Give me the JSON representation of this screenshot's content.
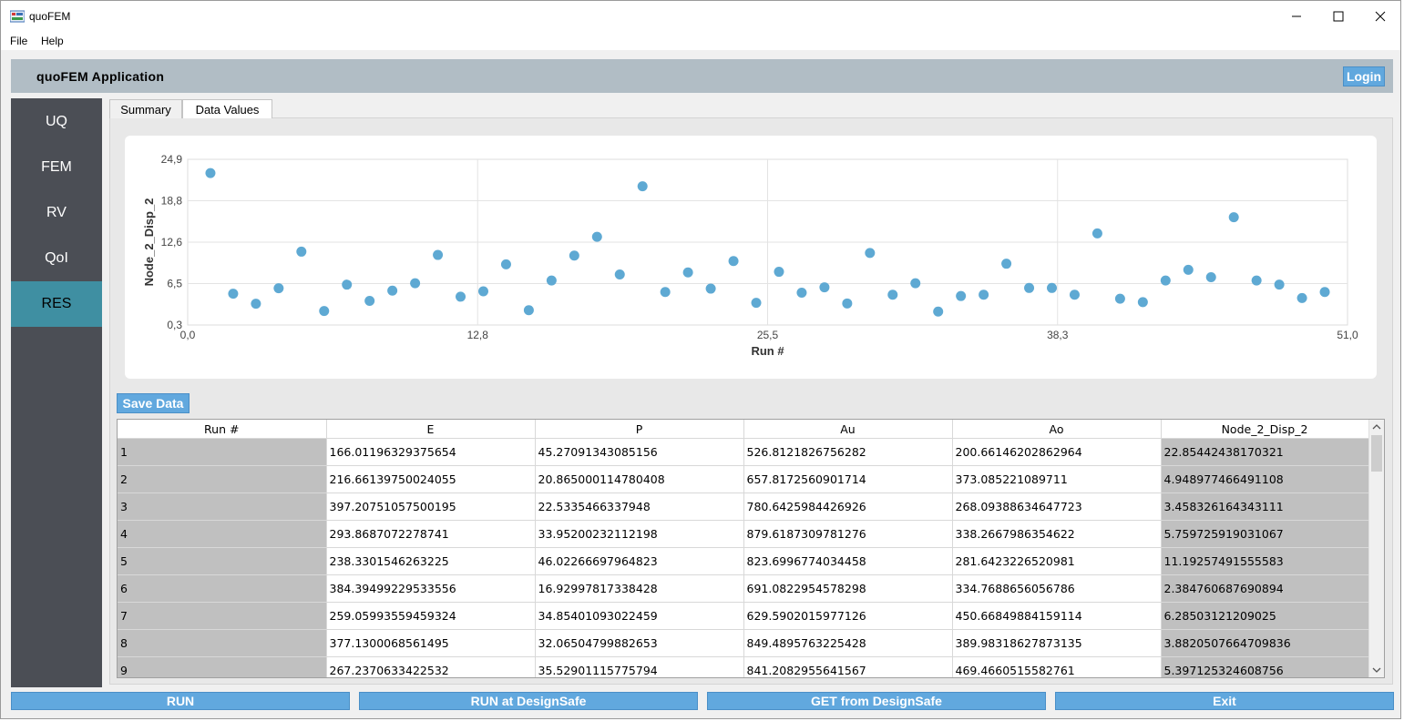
{
  "window": {
    "title": "quoFEM"
  },
  "menu": {
    "items": [
      "File",
      "Help"
    ]
  },
  "header": {
    "title": "quoFEM Application",
    "login_label": "Login"
  },
  "sidebar": {
    "items": [
      "UQ",
      "FEM",
      "RV",
      "QoI",
      "RES"
    ],
    "active": "RES"
  },
  "tabs": {
    "items": [
      "Summary",
      "Data Values"
    ],
    "active": "Data Values"
  },
  "buttons": {
    "save_data": "Save Data",
    "run": "RUN",
    "run_designsafe": "RUN at DesignSafe",
    "get_designsafe": "GET from DesignSafe",
    "exit": "Exit"
  },
  "table": {
    "columns": [
      "Run #",
      "E",
      "P",
      "Au",
      "Ao",
      "Node_2_Disp_2"
    ],
    "rows": [
      [
        "1",
        "166.01196329375654",
        "45.27091343085156",
        "526.8121826756282",
        "200.66146202862964",
        "22.85442438170321"
      ],
      [
        "2",
        "216.66139750024055",
        "20.865000114780408",
        "657.8172560901714",
        "373.085221089711",
        "4.948977466491108"
      ],
      [
        "3",
        "397.20751057500195",
        "22.5335466337948",
        "780.6425984426926",
        "268.09388634647723",
        "3.458326164343111"
      ],
      [
        "4",
        "293.8687072278741",
        "33.95200232112198",
        "879.6187309781276",
        "338.2667986354622",
        "5.759725919031067"
      ],
      [
        "5",
        "238.3301546263225",
        "46.02266697964823",
        "823.6996774034458",
        "281.6423226520981",
        "11.19257491555583"
      ],
      [
        "6",
        "384.39499229533556",
        "16.92997817338428",
        "691.0822954578298",
        "334.7688656056786",
        "2.384760687690894"
      ],
      [
        "7",
        "259.05993559459324",
        "34.85401093022459",
        "629.5902015977126",
        "450.66849884159114",
        "6.28503121209025"
      ],
      [
        "8",
        "377.1300068561495",
        "32.06504799882653",
        "849.4895763225428",
        "389.98318627873135",
        "3.8820507664709836"
      ],
      [
        "9",
        "267.2370633422532",
        "35.52901115775794",
        "841.2082955641567",
        "469.4660515582761",
        "5.397125324608756"
      ]
    ]
  },
  "chart_data": {
    "type": "scatter",
    "xlabel": "Run #",
    "ylabel": "Node_2_Disp_2",
    "xlim": [
      0.0,
      51.0
    ],
    "ylim": [
      0.3,
      24.9
    ],
    "x_ticks": [
      "0,0",
      "12,8",
      "25,5",
      "38,3",
      "51,0"
    ],
    "y_ticks": [
      "0,3",
      "6,5",
      "12,6",
      "18,8",
      "24,9"
    ],
    "grid": true,
    "color": "#5ea9d3",
    "x": [
      1,
      2,
      3,
      4,
      5,
      6,
      7,
      8,
      9,
      10,
      11,
      12,
      13,
      14,
      15,
      16,
      17,
      18,
      19,
      20,
      21,
      22,
      23,
      24,
      25,
      26,
      27,
      28,
      29,
      30,
      31,
      32,
      33,
      34,
      35,
      36,
      37,
      38,
      39,
      40,
      41,
      42,
      43,
      44,
      45,
      46,
      47,
      48,
      49,
      50
    ],
    "y": [
      22.85,
      4.95,
      3.46,
      5.76,
      11.19,
      2.38,
      6.29,
      3.88,
      5.4,
      6.5,
      10.7,
      4.5,
      5.3,
      9.3,
      2.5,
      6.9,
      10.6,
      13.4,
      7.8,
      20.9,
      5.2,
      8.1,
      5.7,
      9.8,
      3.6,
      8.2,
      5.1,
      5.9,
      3.5,
      11.0,
      4.8,
      6.5,
      2.3,
      4.6,
      4.8,
      9.4,
      5.8,
      5.8,
      4.8,
      13.9,
      4.2,
      3.7,
      6.9,
      8.5,
      7.4,
      16.3,
      6.9,
      6.3,
      4.3,
      5.2
    ]
  }
}
